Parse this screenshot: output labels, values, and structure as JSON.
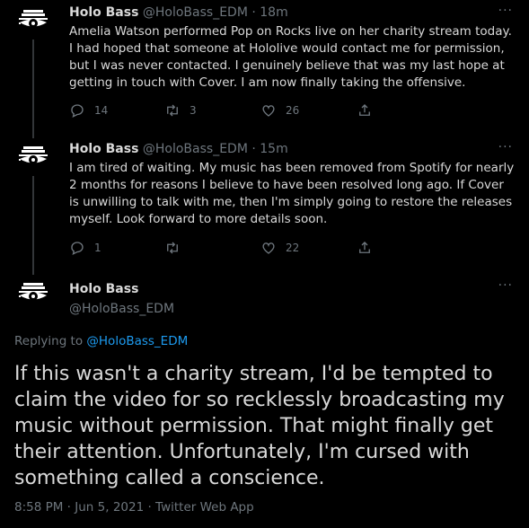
{
  "tweets": [
    {
      "name": "Holo Bass",
      "handle": "@HoloBass_EDM",
      "time": "· 18m",
      "text": "Amelia Watson performed Pop on Rocks live on her charity stream today. I had hoped that someone at Hololive would contact me for permission, but I was never contacted. I genuinely believe that was my last hope at getting in touch with Cover. I am now finally taking the offensive.",
      "replies": "14",
      "retweets": "3",
      "likes": "26"
    },
    {
      "name": "Holo Bass",
      "handle": "@HoloBass_EDM",
      "time": "· 15m",
      "text": "I am tired of waiting. My music has been removed from Spotify for nearly 2 months for reasons I believe to have been resolved long ago. If Cover is unwilling to talk with me, then I'm simply going to restore the releases myself. Look forward to more details soon.",
      "replies": "1",
      "retweets": "",
      "likes": "22"
    }
  ],
  "main_tweet": {
    "name": "Holo Bass",
    "handle": "@HoloBass_EDM",
    "replying_prefix": "Replying to",
    "replying_to": "@HoloBass_EDM",
    "text": "If this wasn't a charity stream, I'd be tempted to claim the video for so recklessly broadcasting my music without permission. That might finally get their attention. Unfortunately, I'm cursed with something called a conscience.",
    "timestamp": "8:58 PM · Jun 5, 2021 · Twitter Web App"
  },
  "more_label": "···",
  "colors": {
    "background": "#000000",
    "text": "#d9d9d9",
    "muted": "#6e767d",
    "link": "#1d9bf0"
  }
}
